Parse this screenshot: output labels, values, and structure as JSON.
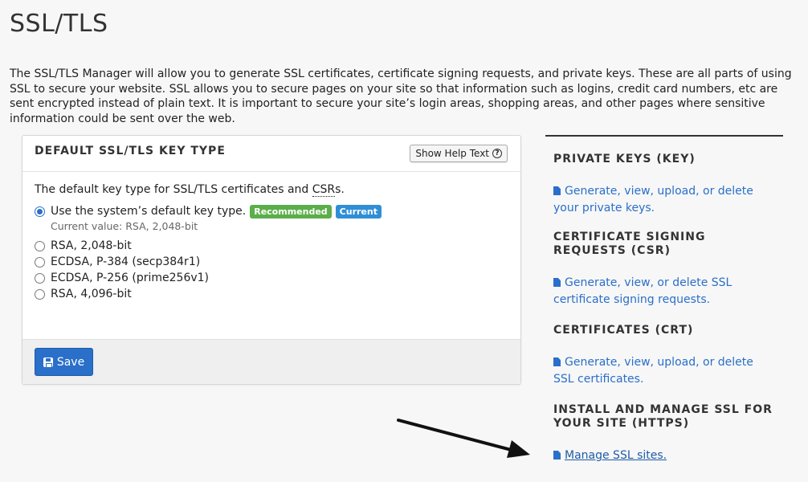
{
  "page": {
    "title": "SSL/TLS",
    "intro": "The SSL/TLS Manager will allow you to generate SSL certificates, certificate signing requests, and private keys. These are all parts of using SSL to secure your website. SSL allows you to secure pages on your site so that information such as logins, credit card numbers, etc are sent encrypted instead of plain text. It is important to secure your site’s login areas, shopping areas, and other pages where sensitive information could be sent over the web."
  },
  "panel": {
    "title": "DEFAULT SSL/TLS KEY TYPE",
    "help_button": "Show Help Text",
    "description_prefix": "The default key type for SSL/TLS certificates and ",
    "description_abbr": "CSR",
    "description_suffix": "s.",
    "options": [
      {
        "label": "Use the system’s default key type.",
        "checked": true
      },
      {
        "label": "RSA, 2,048-bit",
        "checked": false
      },
      {
        "label": "ECDSA, P-384 (secp384r1)",
        "checked": false
      },
      {
        "label": "ECDSA, P-256 (prime256v1)",
        "checked": false
      },
      {
        "label": "RSA, 4,096-bit",
        "checked": false
      }
    ],
    "badges": {
      "recommended": "Recommended",
      "current": "Current"
    },
    "current_value": "Current value: RSA, 2,048-bit",
    "save_label": "Save"
  },
  "sidebar": {
    "sections": [
      {
        "heading": "PRIVATE KEYS (KEY)",
        "link": "Generate, view, upload, or delete your private keys."
      },
      {
        "heading": "CERTIFICATE SIGNING REQUESTS (CSR)",
        "link": "Generate, view, or delete SSL certificate signing requests."
      },
      {
        "heading": "CERTIFICATES (CRT)",
        "link": "Generate, view, upload, or delete SSL certificates."
      },
      {
        "heading": "INSTALL AND MANAGE SSL FOR YOUR SITE (HTTPS)",
        "link": "Manage SSL sites."
      }
    ]
  },
  "colors": {
    "link": "#2a6fc9",
    "recommended": "#5cae4a",
    "current": "#2f8fd6",
    "save": "#2a6fc9"
  }
}
